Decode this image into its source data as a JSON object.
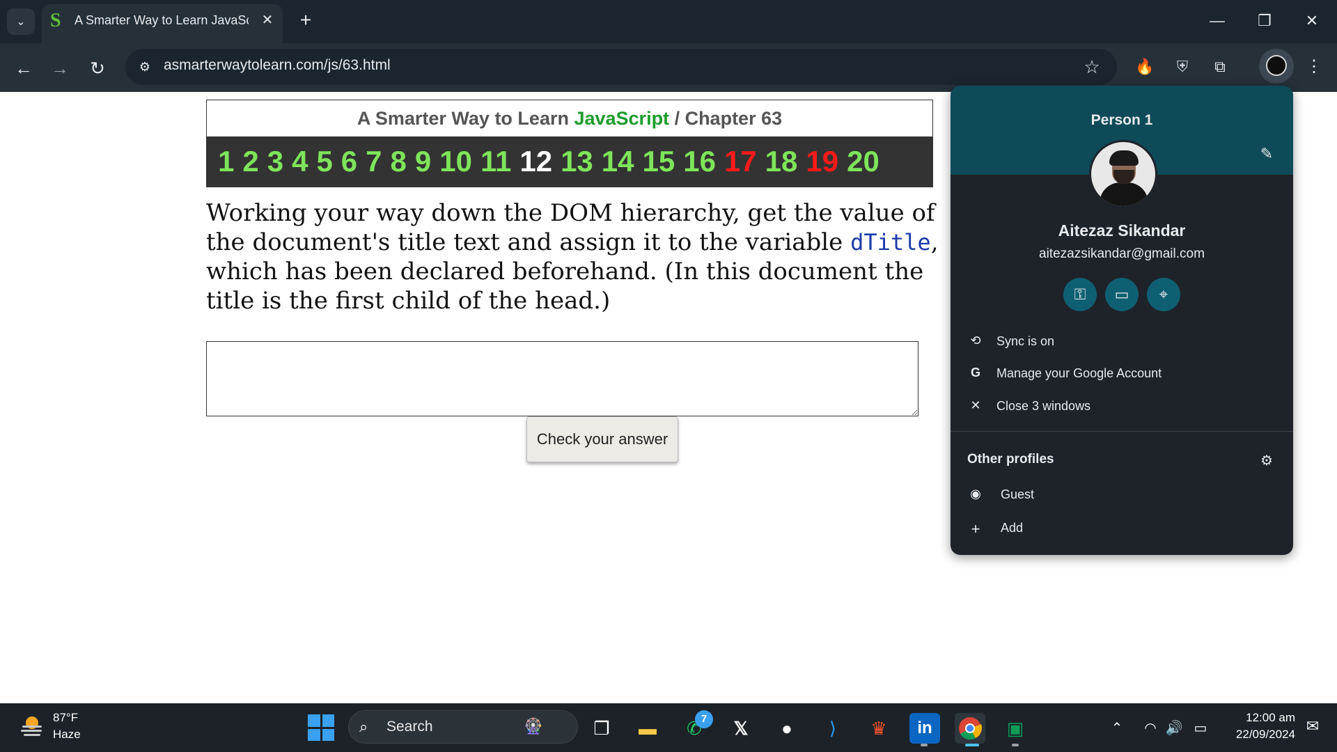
{
  "browser": {
    "tab_title": "A Smarter Way to Learn JavaScript",
    "tab_favicon": "S",
    "url": "asmarterwaytolearn.com/js/63.html"
  },
  "page": {
    "header_prefix": "A Smarter Way to Learn ",
    "header_js": "JavaScript",
    "header_chapter": " / Chapter 63",
    "chapters": [
      {
        "label": "1",
        "color": "#7ee45a"
      },
      {
        "label": "2",
        "color": "#7ee45a"
      },
      {
        "label": "3",
        "color": "#7ee45a"
      },
      {
        "label": "4",
        "color": "#7ee45a"
      },
      {
        "label": "5",
        "color": "#7ee45a"
      },
      {
        "label": "6",
        "color": "#7ee45a"
      },
      {
        "label": "7",
        "color": "#7ee45a"
      },
      {
        "label": "8",
        "color": "#7ee45a"
      },
      {
        "label": "9",
        "color": "#7ee45a"
      },
      {
        "label": "10",
        "color": "#7ee45a"
      },
      {
        "label": "11",
        "color": "#7ee45a"
      },
      {
        "label": "12",
        "color": "#ffffff"
      },
      {
        "label": "13",
        "color": "#7ee45a"
      },
      {
        "label": "14",
        "color": "#7ee45a"
      },
      {
        "label": "15",
        "color": "#7ee45a"
      },
      {
        "label": "16",
        "color": "#7ee45a"
      },
      {
        "label": "17",
        "color": "#ff1a1a"
      },
      {
        "label": "18",
        "color": "#7ee45a"
      },
      {
        "label": "19",
        "color": "#ff1a1a"
      },
      {
        "label": "20",
        "color": "#7ee45a"
      }
    ],
    "instruction_part1": "Working your way down the DOM hierarchy, get the value of the document's title text and assign it to the variable ",
    "instruction_code": "dTitle",
    "instruction_part2": ", which has been declared beforehand. (In this document the title is the first child of the head.)",
    "answer_value": "",
    "check_button": "Check your answer"
  },
  "profile_popup": {
    "person": "Person 1",
    "name": "Aitezaz Sikandar",
    "email": "aitezazsikandar@gmail.com",
    "sync": "Sync is on",
    "manage": "Manage your Google Account",
    "close_windows": "Close 3 windows",
    "other_profiles": "Other profiles",
    "guest": "Guest",
    "add": "Add"
  },
  "taskbar": {
    "temperature": "87°F",
    "condition": "Haze",
    "search_placeholder": "Search",
    "whatsapp_badge": "7",
    "time": "12:00 am",
    "date": "22/09/2024"
  }
}
